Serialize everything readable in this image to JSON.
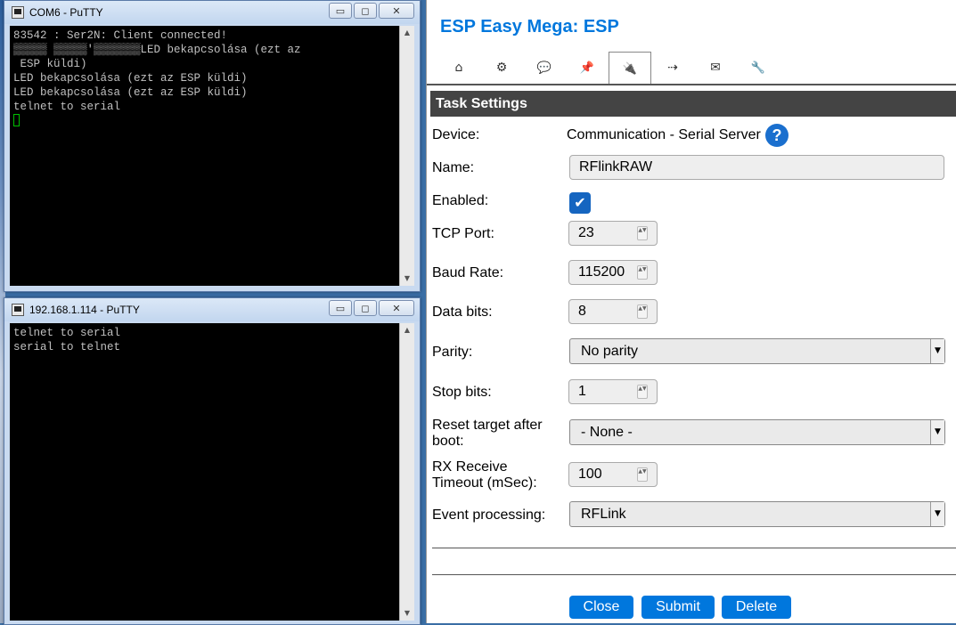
{
  "putty1": {
    "title": "COM6 - PuTTY",
    "lines": [
      "83542 : Ser2N: Client connected!",
      "▒▒▒▒▒ ▒▒▒▒▒'▒▒▒▒▒▒▒LED bekapcsolása (ezt az",
      " ESP küldi)",
      "LED bekapcsolása (ezt az ESP küldi)",
      "LED bekapcsolása (ezt az ESP küldi)",
      "telnet to serial"
    ]
  },
  "putty2": {
    "title": "192.168.1.114 - PuTTY",
    "lines": [
      "telnet to serial",
      "serial to telnet"
    ]
  },
  "window_buttons": {
    "minimize": "▭",
    "maximize": "◻",
    "close": "✕"
  },
  "esp": {
    "title": "ESP Easy Mega: ESP",
    "tabs": [
      {
        "icon": "home-icon",
        "glyph": "⌂"
      },
      {
        "icon": "gear-icon",
        "glyph": "⚙"
      },
      {
        "icon": "chat-icon",
        "glyph": "💬"
      },
      {
        "icon": "pin-icon",
        "glyph": "📌"
      },
      {
        "icon": "plug-icon",
        "glyph": "🔌"
      },
      {
        "icon": "rules-icon",
        "glyph": "⇢"
      },
      {
        "icon": "mail-icon",
        "glyph": "✉"
      },
      {
        "icon": "wrench-icon",
        "glyph": "🔧"
      }
    ],
    "section": "Task Settings",
    "device_label": "Device:",
    "device_value": "Communication - Serial Server",
    "help_glyph": "?",
    "name_label": "Name:",
    "name_value": "RFlinkRAW",
    "enabled_label": "Enabled:",
    "enabled_check": "✔",
    "tcp_label": "TCP Port:",
    "tcp_value": "23",
    "baud_label": "Baud Rate:",
    "baud_value": "115200",
    "databits_label": "Data bits:",
    "databits_value": "8",
    "parity_label": "Parity:",
    "parity_value": "No parity",
    "stopbits_label": "Stop bits:",
    "stopbits_value": "1",
    "reset_label_1": "Reset target after",
    "reset_label_2": "boot:",
    "reset_value": "- None -",
    "rx_label_1": "RX Receive",
    "rx_label_2": "Timeout (mSec):",
    "rx_value": "100",
    "event_label": "Event processing:",
    "event_value": "RFLink",
    "close_btn": "Close",
    "submit_btn": "Submit",
    "delete_btn": "Delete",
    "spin_glyph": "▲▼",
    "caret_glyph": "▼"
  },
  "colors": {
    "accent": "#0077dd",
    "header_bg": "#444444"
  }
}
